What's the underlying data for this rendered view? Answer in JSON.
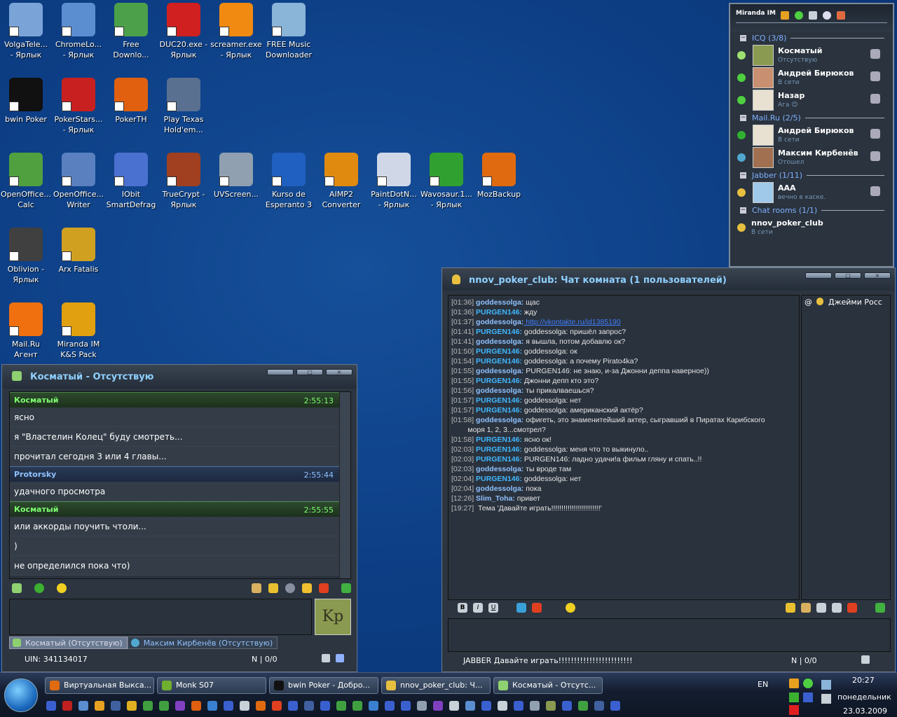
{
  "desktop": {
    "icons": [
      {
        "label": "VolgaTele...\n- Ярлык",
        "icon": "computer-icon",
        "color": "#7aa4d8"
      },
      {
        "label": "ChromeLo...\n- Ярлык",
        "icon": "chrome-icon",
        "color": "#5a8ed0"
      },
      {
        "label": "Free\nDownlo...",
        "icon": "download-icon",
        "color": "#4ca04a"
      },
      {
        "label": "DUC20.exe -\nЯрлык",
        "icon": "ip-icon",
        "color": "#d02020"
      },
      {
        "label": "screamer.exe\n- Ярлык",
        "icon": "radio-icon",
        "color": "#f08a10"
      },
      {
        "label": "FREE Music\nDownloader",
        "icon": "music-icon",
        "color": "#8ab4d8"
      },
      {
        "label": "bwin Poker",
        "icon": "bwin-icon",
        "color": "#111111"
      },
      {
        "label": "PokerStars...\n- Ярлык",
        "icon": "pokerstars-icon",
        "color": "#c82020"
      },
      {
        "label": "PokerTH",
        "icon": "pokerth-icon",
        "color": "#e06010"
      },
      {
        "label": "Play Texas\nHold'em...",
        "icon": "chips-icon",
        "color": "#5a7090"
      },
      {
        "label": "OpenOffice...\nCalc",
        "icon": "calc-icon",
        "color": "#50a040"
      },
      {
        "label": "OpenOffice...\nWriter",
        "icon": "writer-icon",
        "color": "#5a80c0"
      },
      {
        "label": "IObit\nSmartDefrag",
        "icon": "defrag-icon",
        "color": "#4a70d0"
      },
      {
        "label": "TrueCrypt -\nЯрлык",
        "icon": "truecrypt-icon",
        "color": "#a04020"
      },
      {
        "label": "UVScreen...",
        "icon": "camera-icon",
        "color": "#90a0b0"
      },
      {
        "label": "Kurso de\nEsperanto 3",
        "icon": "globe-icon",
        "color": "#2060c0"
      },
      {
        "label": "AIMP2\nConverter",
        "icon": "aimp-icon",
        "color": "#e08a10"
      },
      {
        "label": "PaintDotN...\n- Ярлык",
        "icon": "paint-icon",
        "color": "#d0d8e8"
      },
      {
        "label": "Wavosaur.1...\n- Ярлык",
        "icon": "wavosaur-icon",
        "color": "#30a030"
      },
      {
        "label": "MozBackup",
        "icon": "mozbackup-icon",
        "color": "#e06a10"
      },
      {
        "label": "Oblivion -\nЯрлык",
        "icon": "oblivion-icon",
        "color": "#404040"
      },
      {
        "label": "Arx Fatalis",
        "icon": "arx-icon",
        "color": "#d0a020"
      },
      {
        "label": "Mail.Ru\nАгент",
        "icon": "mailru-icon",
        "color": "#f07010"
      },
      {
        "label": "Miranda IM\nK&S Pack",
        "icon": "miranda-icon",
        "color": "#e0a010"
      }
    ]
  },
  "chat1": {
    "title": "Косматый - Отсутствую",
    "messages": [
      {
        "nick": "Косматый",
        "time": "2:55:13",
        "color": "green",
        "lines": [
          "ясно",
          "я \"Властелин Колец\" буду смотреть...",
          "прочитал сегодня 3 или 4 главы..."
        ]
      },
      {
        "nick": "Protorsky",
        "time": "2:55:44",
        "color": "blue",
        "lines": [
          "удачного просмотра"
        ]
      },
      {
        "nick": "Косматый",
        "time": "2:55:55",
        "color": "green",
        "lines": [
          "или аккорды поучить чтоли...",
          ")",
          "не определился пока что)"
        ]
      }
    ],
    "tabs": [
      "Косматый (Отсутствую)",
      "Максим Кирбенёв (Отсутствую)"
    ],
    "status_uin": "UIN: 341134017",
    "status_right": "N | 0/0"
  },
  "chat2": {
    "title": "nnov_poker_club: Чат комната (1 пользователей)",
    "log": [
      {
        "ts": "[01:36]",
        "nick": "goddessolga:",
        "text": " щас"
      },
      {
        "ts": "[01:36]",
        "nick": "PURGEN146:",
        "text": " жду"
      },
      {
        "ts": "[01:37]",
        "nick": "goddessolga:",
        "link": " http://vkontakte.ru/id1385190"
      },
      {
        "ts": "[01:41]",
        "nick": "PURGEN146:",
        "text": " goddessolga: пришёл запрос?"
      },
      {
        "ts": "[01:41]",
        "nick": "goddessolga:",
        "text": " я вышла, потом добавлю ок?"
      },
      {
        "ts": "[01:50]",
        "nick": "PURGEN146:",
        "text": " goddessolga: ок"
      },
      {
        "ts": "[01:54]",
        "nick": "PURGEN146:",
        "text": " goddessolga: а почему Pirato4ka?"
      },
      {
        "ts": "[01:55]",
        "nick": "goddessolga:",
        "text": " PURGEN146: не знаю, и-за Джонни деппа наверное))"
      },
      {
        "ts": "[01:55]",
        "nick": "PURGEN146:",
        "text": " Джонни депп кто это?"
      },
      {
        "ts": "[01:56]",
        "nick": "goddessolga:",
        "text": " ты прикалваешься?"
      },
      {
        "ts": "[01:57]",
        "nick": "PURGEN146:",
        "text": " goddessolga: нет"
      },
      {
        "ts": "[01:57]",
        "nick": "PURGEN146:",
        "text": " goddessolga: американский актёр?"
      },
      {
        "ts": "[01:58]",
        "nick": "goddessolga:",
        "text": " офигеть, это знаменитейший актер, сыгравший в Пиратах Карибского\n        моря 1, 2, 3...смотрел?"
      },
      {
        "ts": "[01:58]",
        "nick": "PURGEN146:",
        "text": " ясно ок!"
      },
      {
        "ts": "[02:03]",
        "nick": "PURGEN146:",
        "text": " goddessolga: меня что то выкинуло.."
      },
      {
        "ts": "[02:03]",
        "nick": "PURGEN146:",
        "text": " PURGEN146: ладно удачи!а фильм гляну и спать..!!"
      },
      {
        "ts": "[02:03]",
        "nick": "goddessolga:",
        "text": " ты вроде там"
      },
      {
        "ts": "[02:04]",
        "nick": "PURGEN146:",
        "text": " goddessolga: нет"
      },
      {
        "ts": "[02:04]",
        "nick": "goddessolga:",
        "text": " пока"
      },
      {
        "ts": "[12:26]",
        "nick": "Slim_Toha:",
        "text": " привет"
      },
      {
        "ts": "[19:27]",
        "nick": "",
        "text": " Тема 'Давайте играть!!!!!!!!!!!!!!!!!!!!!!!!'"
      }
    ],
    "users": [
      "@",
      "Джейми Росс"
    ],
    "status": "JABBER Давайте играть!!!!!!!!!!!!!!!!!!!!!!!!",
    "status_right": "N | 0/0"
  },
  "miranda": {
    "title": "Miranda IM",
    "groups": [
      {
        "name": "ICQ  (3/8)",
        "contacts": [
          {
            "name": "Косматый",
            "status": "Отсутствую",
            "sicon": "#9ee070"
          },
          {
            "name": "Андрей Бирюков",
            "status": "В сети",
            "sicon": "#4ed040"
          },
          {
            "name": "Назар",
            "status": "Ага 😊",
            "sicon": "#4ed040"
          }
        ]
      },
      {
        "name": "Mail.Ru  (2/5)",
        "contacts": [
          {
            "name": "Андрей Бирюков",
            "status": "В сети",
            "sicon": "#30b030"
          },
          {
            "name": "Максим Кирбенёв",
            "status": "Отошел",
            "sicon": "#50a8d0"
          }
        ]
      },
      {
        "name": "Jabber  (1/11)",
        "contacts": [
          {
            "name": "AAA",
            "status": "вечно в каске.",
            "sicon": "#e8c040"
          }
        ]
      },
      {
        "name": "Chat rooms  (1/1)",
        "contacts": [
          {
            "name": "nnov_poker_club",
            "status": "В сети",
            "sicon": "#e8c040"
          }
        ]
      }
    ]
  },
  "taskbar": {
    "tasks": [
      "Виртуальная Выкса...",
      "Monk S07",
      "bwin Poker - Добро...",
      "nnov_poker_club: Ч...",
      "Косматый - Отсутс..."
    ],
    "lang": "EN",
    "time": "20:27",
    "day": "понедельник",
    "date": "23.03.2009"
  }
}
